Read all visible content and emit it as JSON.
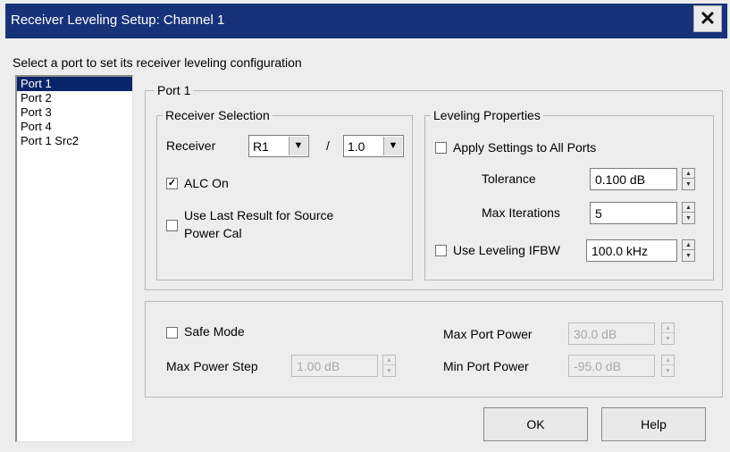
{
  "window": {
    "title": "Receiver Leveling Setup: Channel 1",
    "close_label": "✕"
  },
  "instruction": "Select a port to set its receiver leveling configuration",
  "ports": {
    "items": [
      "Port 1",
      "Port 2",
      "Port 3",
      "Port 4",
      "Port 1 Src2"
    ],
    "selected": "Port 1"
  },
  "port_group": {
    "title": "Port 1",
    "receiver_selection": {
      "title": "Receiver Selection",
      "receiver_label": "Receiver",
      "receiver_value": "R1",
      "divider": "/",
      "ratio_value": "1.0",
      "alc_label": "ALC On",
      "alc_checked": true,
      "alc_mark": "✓",
      "use_last_label_line1": "Use Last Result for Source",
      "use_last_label_line2": "Power Cal",
      "use_last_checked": false
    },
    "leveling_properties": {
      "title": "Leveling Properties",
      "apply_all_label": "Apply Settings to All Ports",
      "apply_all_checked": false,
      "tolerance_label": "Tolerance",
      "tolerance_value": "0.100 dB",
      "max_iterations_label": "Max Iterations",
      "max_iterations_value": "5",
      "ifbw_label": "Use Leveling IFBW",
      "ifbw_checked": false,
      "ifbw_value": "100.0 kHz"
    }
  },
  "safe_mode": {
    "label": "Safe Mode",
    "checked": false,
    "max_power_step_label": "Max Power Step",
    "max_power_step_value": "1.00 dB",
    "max_port_power_label": "Max Port Power",
    "max_port_power_value": "30.0 dB",
    "min_port_power_label": "Min Port Power",
    "min_port_power_value": "-95.0 dB"
  },
  "buttons": {
    "ok": "OK",
    "help": "Help"
  },
  "icons": {
    "combo_arrow": "▼",
    "spin_up": "▲",
    "spin_down": "▼"
  },
  "colors": {
    "titlebar": "#16337a",
    "selection": "#0a246a",
    "dialog_bg": "#ededed"
  }
}
